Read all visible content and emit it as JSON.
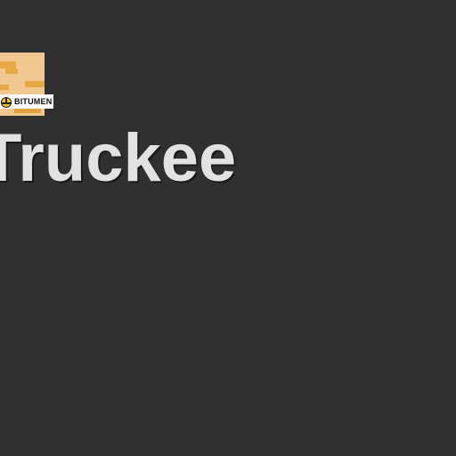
{
  "page": {
    "background": "#303030"
  },
  "thumbnail": {
    "brand_text": "BITUMEN",
    "brand_icon": "hardhat-icon",
    "colors": {
      "tile": "#f0c890",
      "accent": "#e8a845"
    }
  },
  "title": {
    "text": "Truckee",
    "color": "#e2e2e2"
  }
}
